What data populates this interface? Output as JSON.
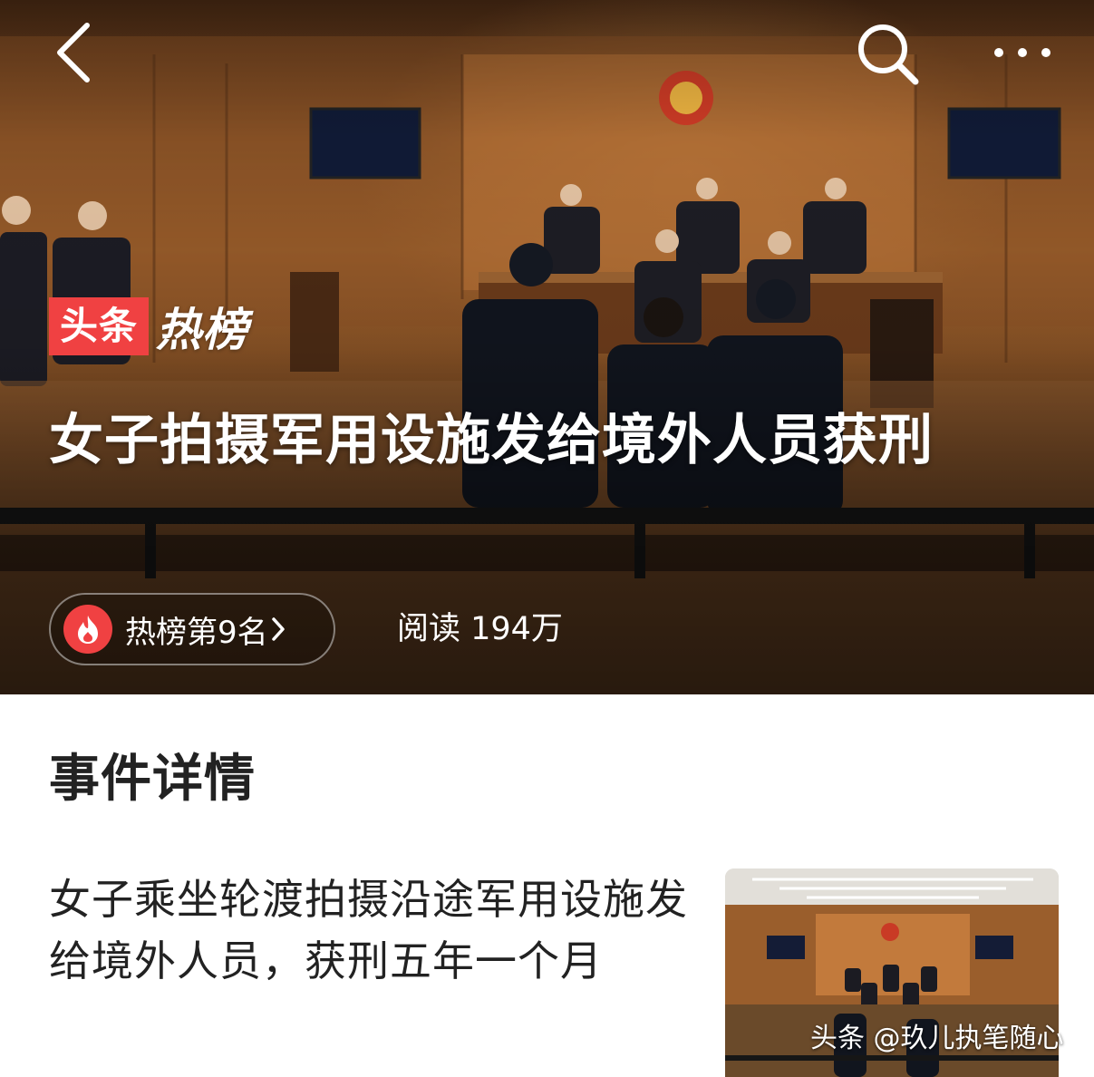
{
  "hero": {
    "brand_red": "头条",
    "brand_white": "热榜",
    "headline": "女子拍摄军用设施发给境外人员获刑",
    "rank_label": "热榜第9名",
    "reads_label": "阅读 194万"
  },
  "nav": {
    "back_icon": "chevron-left-icon",
    "search_icon": "search-icon",
    "more_icon": "more-horizontal-icon"
  },
  "section": {
    "title": "事件详情",
    "event_text": "女子乘坐轮渡拍摄沿途军用设施发给境外人员，获刑五年一个月"
  },
  "watermark": "头条 @玖儿执笔随心",
  "colors": {
    "brand_red": "#f04142",
    "text_dark": "#222222"
  }
}
